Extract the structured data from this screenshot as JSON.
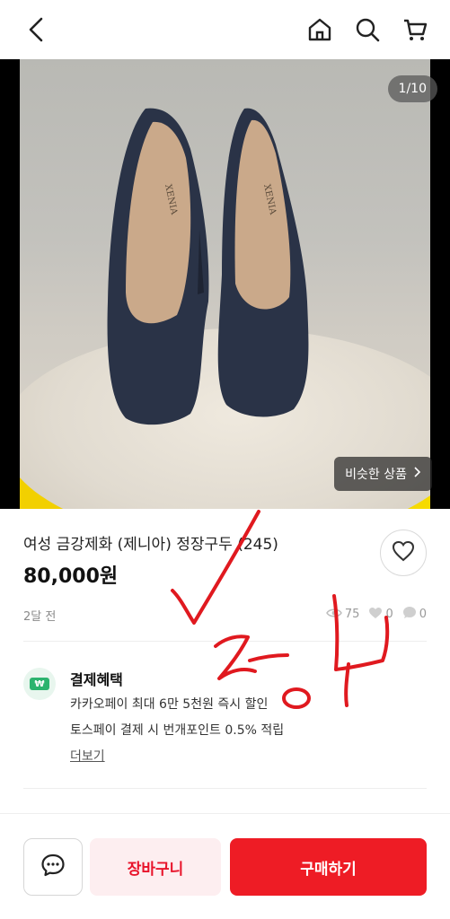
{
  "header": {
    "back_icon": "chevron-left-icon",
    "home_icon": "home-icon",
    "search_icon": "search-icon",
    "cart_icon": "cart-icon"
  },
  "gallery": {
    "counter": "1/10",
    "similar_label": "비슷한 상품",
    "shoe_brand": "XENIA"
  },
  "product": {
    "title": "여성 금강제화 (제니아) 정장구두 (245)",
    "price": "80,000원",
    "posted": "2달 전",
    "views": "75",
    "likes": "0",
    "chats": "0"
  },
  "benefits": {
    "title": "결제혜택",
    "icon_label": "₩",
    "line1": "카카오페이 최대 6만 5천원 즉시 할인",
    "line2": "토스페이 결제 시 번개포인트 0.5% 적립",
    "more": "더보기"
  },
  "bottom": {
    "cart_label": "장바구니",
    "buy_label": "구매하기"
  },
  "colors": {
    "accent": "#ee1c25",
    "cart_bg": "#fdeef0",
    "benefit_green": "#2bb36e",
    "annotation_red": "#e0191f"
  }
}
